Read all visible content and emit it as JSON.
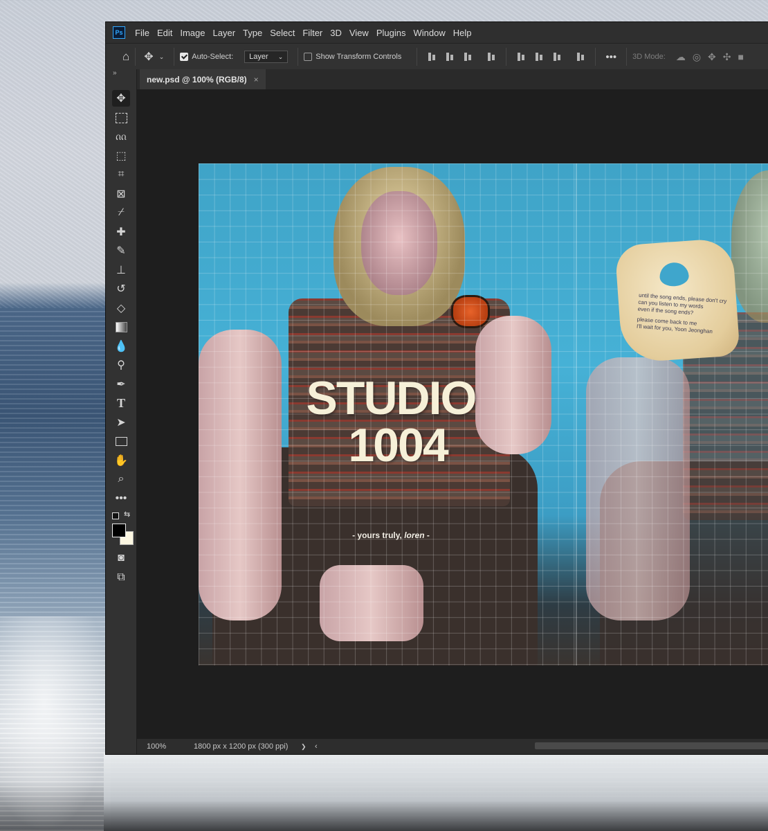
{
  "menubar": {
    "logo": "Ps",
    "items": [
      "File",
      "Edit",
      "Image",
      "Layer",
      "Type",
      "Select",
      "Filter",
      "3D",
      "View",
      "Plugins",
      "Window",
      "Help"
    ]
  },
  "options": {
    "auto_select_label": "Auto-Select:",
    "auto_select_value": "Layer",
    "transform_label": "Show Transform Controls",
    "mode_label": "3D Mode:"
  },
  "document": {
    "tab_title": "new.psd @ 100% (RGB/8)",
    "close_glyph": "×"
  },
  "artwork": {
    "title_line1": "STUDIO",
    "title_line2": "1004",
    "signature_prefix": "- yours truly, ",
    "signature_name": "loren",
    "signature_suffix": " -",
    "tag_lines": [
      "until the song ends, please don't cry",
      "can you listen to my words",
      "even if the song ends?",
      "",
      "please come back to me",
      "I'll wait for you, Yoon Jeonghan"
    ]
  },
  "status": {
    "zoom": "100%",
    "doc_info": "1800 px x 1200 px (300 ppi)",
    "nav_next": "❯",
    "nav_prev": "‹"
  },
  "colors": {
    "ui_dark": "#282828",
    "canvas_blue": "#46b1d6",
    "title_cream": "#f6f0d8",
    "watch_orange": "#e8632a"
  }
}
